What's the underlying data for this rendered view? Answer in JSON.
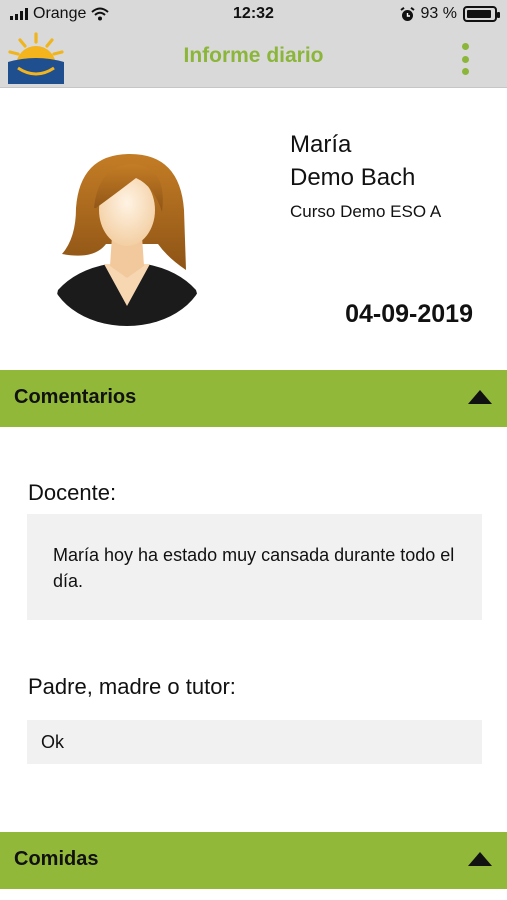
{
  "status_bar": {
    "carrier": "Orange",
    "time": "12:32",
    "battery_percent": "93 %",
    "battery_level": 0.93
  },
  "header": {
    "title": "Informe diario",
    "menu_icon": "more-vertical-icon",
    "logo_icon": "sun-logo-icon"
  },
  "student": {
    "first_name": "María",
    "last_name": "Demo Bach",
    "course": "Curso Demo ESO A"
  },
  "report": {
    "date": "04-09-2019"
  },
  "sections": {
    "comments": {
      "title": "Comentarios",
      "teacher_label": "Docente:",
      "teacher_comment": "María hoy ha estado muy cansada durante todo el día.",
      "parent_label": "Padre, madre o tutor:",
      "parent_comment": "Ok"
    },
    "meals": {
      "title": "Comidas"
    }
  },
  "colors": {
    "accent": "#8bb63a",
    "section_bar": "#92b83a",
    "header_bg": "#d9d9d9",
    "comment_bg": "#f1f1f1"
  }
}
